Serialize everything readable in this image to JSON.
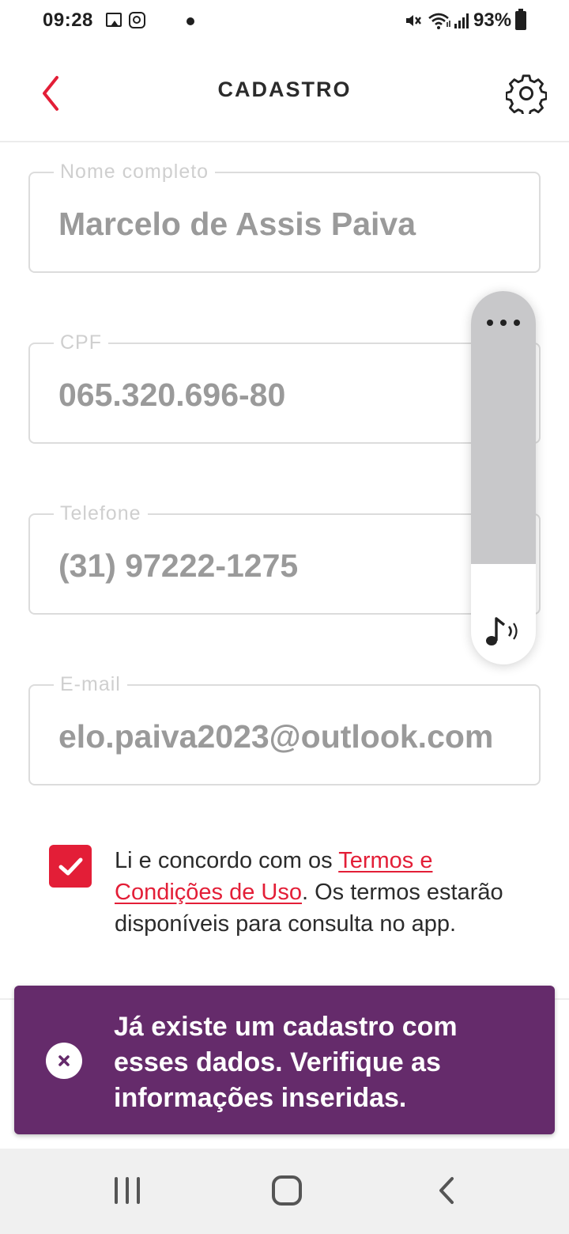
{
  "status_bar": {
    "time": "09:28",
    "battery_percent": "93%",
    "icons": [
      "gallery-icon",
      "instagram-icon",
      "dot-icon",
      "mute-icon",
      "wifi-icon",
      "signal-icon",
      "battery-icon"
    ]
  },
  "header": {
    "title": "CADASTRO",
    "back_icon": "chevron-left-icon",
    "settings_icon": "gear-icon"
  },
  "form": {
    "fields": [
      {
        "label": "Nome completo",
        "value": "Marcelo de Assis Paiva"
      },
      {
        "label": "CPF",
        "value": "065.320.696-80"
      },
      {
        "label": "Telefone",
        "value": "(31) 97222-1275"
      },
      {
        "label": "E-mail",
        "value": "elo.paiva2023@outlook.com"
      }
    ]
  },
  "terms": {
    "checked": true,
    "text_before": "Li e concordo com os ",
    "link_text": "Termos e Condições de Uso",
    "text_after": ". Os termos estarão disponíveis para consulta no app."
  },
  "toast": {
    "message": "Já existe um cadastro com esses dados. Verifique as informações inseridas.",
    "icon": "close-icon",
    "background_color": "#652b6b"
  },
  "volume_panel": {
    "level_fraction": 0.27,
    "more_icon": "more-horizontal-icon",
    "stream_icon": "music-note-icon"
  },
  "nav_bar": {
    "icons": [
      "recent-apps-icon",
      "home-icon",
      "back-icon"
    ]
  },
  "colors": {
    "accent": "#e31e37",
    "toast": "#652b6b",
    "field_text": "#9a9a9a"
  }
}
